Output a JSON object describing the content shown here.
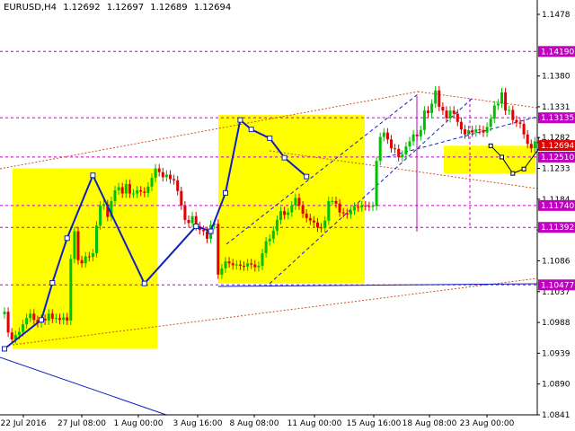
{
  "chart_data": {
    "type": "candlestick",
    "header": {
      "symbol": "EURUSD,H4",
      "values": [
        "1.12692",
        "1.12697",
        "1.12689",
        "1.12694"
      ]
    },
    "x_ticks": [
      "22 Jul 2016",
      "27 Jul 08:00",
      "1 Aug 00:00",
      "3 Aug 16:00",
      "8 Aug 08:00",
      "11 Aug 00:00",
      "15 Aug 16:00",
      "18 Aug 08:00",
      "23 Aug 00:00"
    ],
    "y_ticks": [
      1.1478,
      1.138,
      1.1331,
      1.1282,
      1.1233,
      1.1184,
      1.1135,
      1.1086,
      1.1037,
      1.0988,
      1.0939,
      1.089,
      1.0841
    ],
    "ylim": [
      1.0841,
      1.1478
    ],
    "current_price": "1.12694",
    "levels": [
      {
        "label": "1.14190",
        "value": 1.1419
      },
      {
        "label": "1.13135",
        "value": 1.13135
      },
      {
        "label": "1.12510",
        "value": 1.1251
      },
      {
        "label": "1.11740",
        "value": 1.1174
      },
      {
        "label": "1.11392",
        "value": 1.11392
      },
      {
        "label": "1.10477",
        "value": 1.10477
      }
    ],
    "colors": {
      "bull": "#00c000",
      "bear": "#e00000",
      "level": "#c000c0",
      "zone": "#ffff00",
      "wave": "#1020c0",
      "channel": "#1020c0",
      "fan": "#d05020",
      "price_label": "#e00000"
    },
    "closes": [
      1.1005,
      1.0972,
      1.0961,
      1.0968,
      1.0973,
      1.0985,
      1.0995,
      1.1002,
      1.0992,
      1.0987,
      1.0994,
      1.0991,
      1.1002,
      1.0994,
      1.0995,
      1.0992,
      1.0996,
      1.0991,
      1.1089,
      1.1133,
      1.1087,
      1.1082,
      1.1093,
      1.1092,
      1.1098,
      1.1142,
      1.1174,
      1.1176,
      1.1156,
      1.1181,
      1.1198,
      1.1203,
      1.1193,
      1.1208,
      1.1193,
      1.1193,
      1.1198,
      1.1196,
      1.1194,
      1.1204,
      1.1218,
      1.1233,
      1.1227,
      1.1219,
      1.1223,
      1.1216,
      1.1214,
      1.1197,
      1.1174,
      1.1151,
      1.1146,
      1.1157,
      1.1141,
      1.1135,
      1.1133,
      1.1121,
      1.1143,
      1.1145,
      1.1064,
      1.1074,
      1.1085,
      1.1082,
      1.1079,
      1.108,
      1.1078,
      1.1077,
      1.1082,
      1.108,
      1.1076,
      1.1078,
      1.1098,
      1.1117,
      1.1121,
      1.1134,
      1.1151,
      1.1165,
      1.1159,
      1.1163,
      1.1174,
      1.1186,
      1.1174,
      1.1161,
      1.1154,
      1.115,
      1.1147,
      1.1139,
      1.1138,
      1.115,
      1.1181,
      1.1181,
      1.1177,
      1.1163,
      1.1162,
      1.116,
      1.1166,
      1.1172,
      1.1171,
      1.1174,
      1.1173,
      1.1172,
      1.1173,
      1.1245,
      1.1283,
      1.129,
      1.1279,
      1.1265,
      1.1264,
      1.1251,
      1.1255,
      1.1268,
      1.1276,
      1.1287,
      1.1284,
      1.1294,
      1.1325,
      1.1321,
      1.1336,
      1.1357,
      1.1331,
      1.1325,
      1.1313,
      1.1325,
      1.132,
      1.1307,
      1.1295,
      1.1287,
      1.1294,
      1.129,
      1.1295,
      1.1294,
      1.129,
      1.1299,
      1.1312,
      1.1333,
      1.1336,
      1.1354,
      1.1325,
      1.1326,
      1.131,
      1.1306,
      1.1304,
      1.1287,
      1.1272,
      1.1265,
      1.1276,
      1.1273,
      1.1272,
      1.1269
    ],
    "zones": [
      {
        "start": 1.0946,
        "end": 1.1233
      },
      {
        "start": 1.105,
        "end": 1.1318
      },
      {
        "start": 1.1225,
        "end": 1.1269
      }
    ],
    "wave_points": [
      [
        0,
        1.0946
      ],
      [
        10,
        1.0992
      ],
      [
        13,
        1.1051
      ],
      [
        17,
        1.1122
      ],
      [
        24,
        1.1222
      ],
      [
        38,
        1.105
      ],
      [
        52,
        1.1141
      ],
      [
        56,
        1.1133
      ],
      [
        60,
        1.1194
      ],
      [
        64,
        1.131
      ],
      [
        67,
        1.1295
      ],
      [
        72,
        1.1281
      ],
      [
        76,
        1.125
      ],
      [
        82,
        1.122
      ]
    ],
    "forecast_points": [
      [
        132,
        1.1269
      ],
      [
        135,
        1.1251
      ],
      [
        138,
        1.1225
      ],
      [
        141,
        1.1232
      ],
      [
        146,
        1.1272
      ]
    ]
  }
}
